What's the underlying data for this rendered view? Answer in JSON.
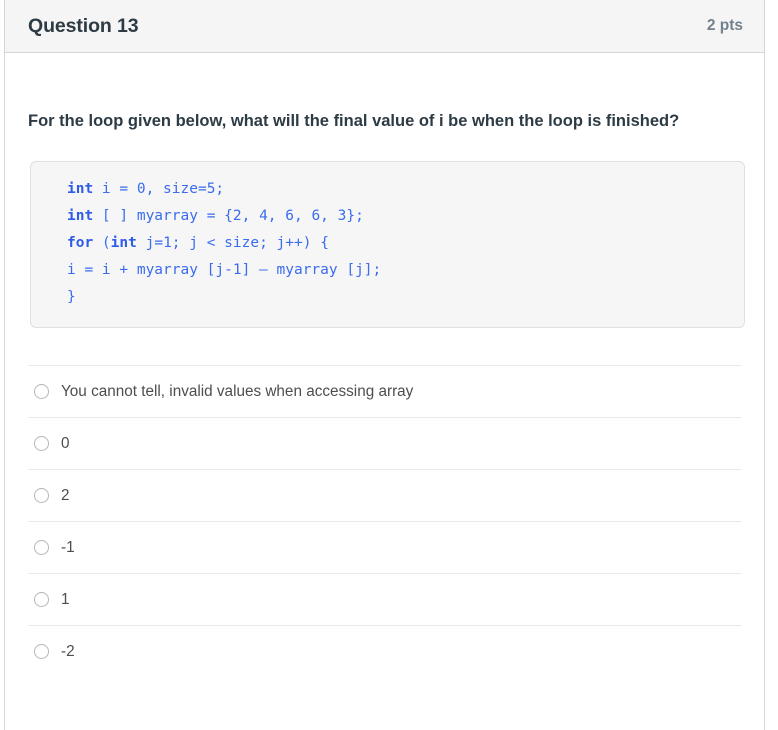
{
  "header": {
    "title": "Question 13",
    "points": "2 pts"
  },
  "question": {
    "prompt": "For the loop given below, what will the final value of i be when the loop is finished?",
    "code_lines": [
      [
        {
          "t": "int",
          "kw": true
        },
        {
          "t": " i = 0, size=5;",
          "kw": false
        }
      ],
      [
        {
          "t": "int",
          "kw": true
        },
        {
          "t": " [ ] myarray = {2, 4, 6, 6, 3};",
          "kw": false
        }
      ],
      [
        {
          "t": "for",
          "kw": true
        },
        {
          "t": " (",
          "kw": false
        },
        {
          "t": "int",
          "kw": true
        },
        {
          "t": " j=1; j < size; j++) {",
          "kw": false
        }
      ],
      [
        {
          "t": "i = i + myarray [j-1] – myarray [j];",
          "kw": false
        }
      ],
      [
        {
          "t": "}",
          "kw": false
        }
      ]
    ]
  },
  "answers": [
    {
      "label": "You cannot tell, invalid values when accessing array",
      "selected": false
    },
    {
      "label": "0",
      "selected": false
    },
    {
      "label": "2",
      "selected": false
    },
    {
      "label": "-1",
      "selected": false
    },
    {
      "label": "1",
      "selected": false
    },
    {
      "label": "-2",
      "selected": false
    }
  ],
  "colors": {
    "header_bg": "#f5f5f5",
    "title_text": "#2d3b45",
    "points_text": "#73818c",
    "code_text": "#3b6ced",
    "code_bg": "#f6f6f6",
    "border": "#d6d6d6",
    "separator": "#e9e9e9",
    "radio_border": "#b4b7b9",
    "answer_text": "#4d4d4d"
  }
}
